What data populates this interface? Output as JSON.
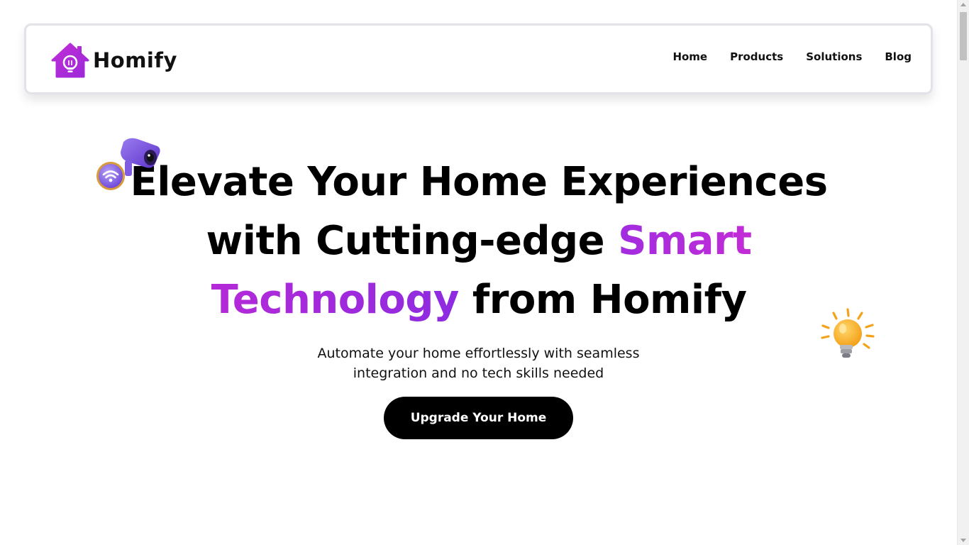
{
  "brand": {
    "name": "Homify",
    "logo_icon": "house-lightbulb-icon",
    "accent_color": "#b22ad9"
  },
  "nav": {
    "items": [
      {
        "label": "Home"
      },
      {
        "label": "Products"
      },
      {
        "label": "Solutions"
      },
      {
        "label": "Blog"
      }
    ]
  },
  "hero": {
    "title_line1": "Elevate Your Home Experiences",
    "title_line2_a": "with Cutting-edge ",
    "title_line2_b": "Smart",
    "title_line3_a": "Technology",
    "title_line3_b": " from Homify",
    "subtitle_line1": "Automate your home effortlessly with seamless",
    "subtitle_line2": "integration and no tech skills needed",
    "cta_label": "Upgrade Your Home",
    "decor_left_icon": "security-camera-wifi-icon",
    "decor_right_icon": "lightbulb-icon"
  }
}
